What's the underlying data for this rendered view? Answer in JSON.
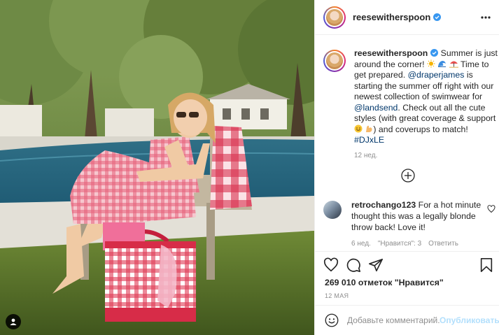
{
  "post": {
    "username": "reesewitherspoon",
    "caption": {
      "username": "reesewitherspoon",
      "text_1": " Summer is just around the corner! ",
      "text_2": " Time to get prepared. ",
      "mention_1": "@draperjames",
      "text_3": " is starting the summer off right with our newest collection of swimwear for ",
      "mention_2": "@landsend",
      "text_4": ". Check out all the cute styles (with great coverage & support ",
      "text_5": ") and coverups to match! ",
      "hashtag": "#DJxLE",
      "time_ago": "12 нед."
    },
    "comments": [
      {
        "username": "retrochango123",
        "text": " For a hot minute thought this was a legally blonde throw back! Love it!",
        "time_ago": "6 нед.",
        "likes_label": "\"Нравится\": 3",
        "reply_label": "Ответить"
      }
    ],
    "likes_text": "269 010 отметок \"Нравится\"",
    "date": "12 МАЯ",
    "add_comment": {
      "placeholder": "Добавьте комментарий...",
      "post_label": "Опубликовать"
    },
    "colors": {
      "link": "#00376b",
      "verified": "#3897f0",
      "post_button_disabled": "#b2dffc"
    },
    "icons": [
      "verified-badge-icon",
      "more-options-icon",
      "sun-emoji-icon",
      "wave-emoji-icon",
      "umbrella-emoji-icon",
      "smile-emoji-icon",
      "flexed-biceps-emoji-icon",
      "plus-circle-icon",
      "heart-icon",
      "comment-icon",
      "share-icon",
      "bookmark-icon",
      "emoji-icon",
      "user-tag-icon"
    ]
  }
}
